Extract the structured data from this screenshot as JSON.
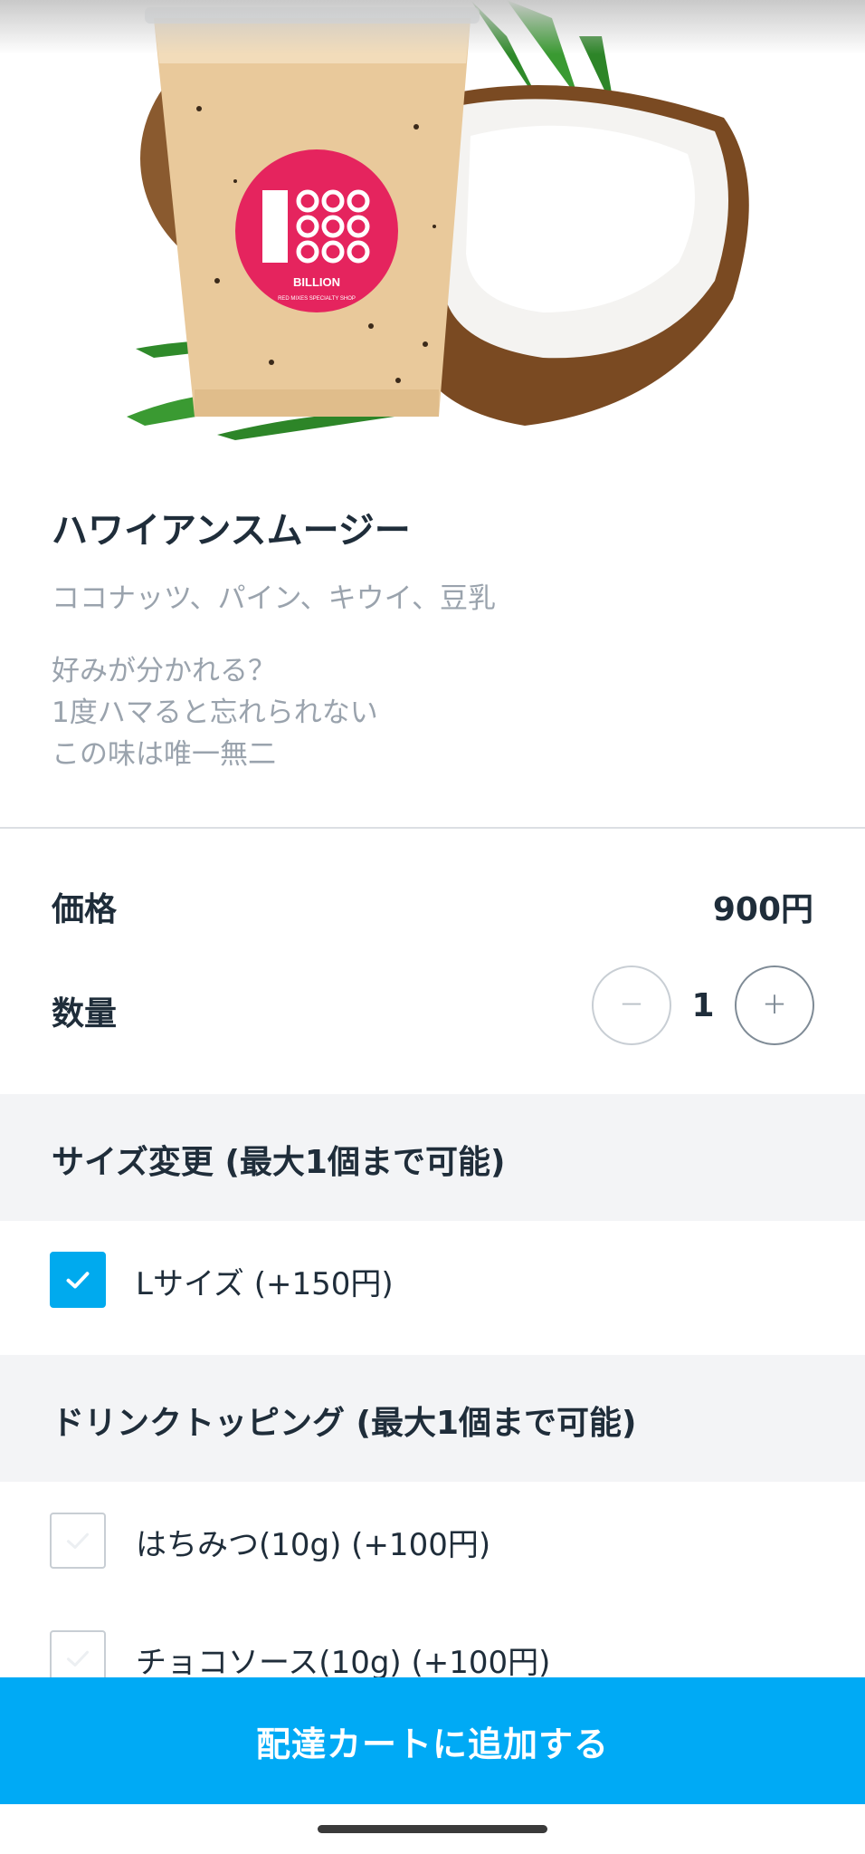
{
  "product": {
    "image_name": "smoothie-with-coconut",
    "logo_text": "1",
    "logo_brand": "BILLION",
    "logo_tagline": "RED MIXES SPECIALTY SHOP",
    "title": "ハワイアンスムージー",
    "subtitle": "ココナッツ、パイン、キウイ、豆乳",
    "description": [
      "好みが分かれる？",
      "1度ハマると忘れられない",
      "この味は唯一無二"
    ]
  },
  "price": {
    "label": "価格",
    "value": "900円"
  },
  "quantity": {
    "label": "数量",
    "minus": "－",
    "plus": "＋",
    "value": "1"
  },
  "sections": [
    {
      "title": "サイズ変更 (最大1個まで可能)",
      "options": [
        {
          "label": "Lサイズ (+150円)",
          "checked": true
        }
      ]
    },
    {
      "title": "ドリンクトッピング (最大1個まで可能)",
      "options": [
        {
          "label": "はちみつ(10g) (+100円)",
          "checked": false
        },
        {
          "label": "チョコソース(10g) (+100円)",
          "checked": false
        }
      ]
    }
  ],
  "cta": {
    "label": "配達カートに追加する"
  },
  "colors": {
    "accent": "#00aaf5",
    "logo_pink": "#e5245e",
    "text": "#1f2d3a",
    "muted": "#9aa3ad"
  }
}
